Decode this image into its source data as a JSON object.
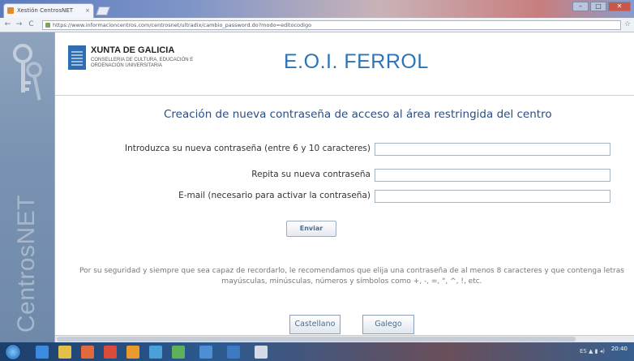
{
  "browser": {
    "tab_title": "Xestión CentrosNET",
    "tab_close": "×",
    "url": "https://www.informacioncentros.com/centrosnet/ultradix/cambio_password.do?modo=editocodigo",
    "back_glyph": "←",
    "forward_glyph": "→",
    "reload_glyph": "C",
    "tools_glyph": "☆",
    "window_buttons": [
      "–",
      "□",
      "✕"
    ]
  },
  "sidebar": {
    "brand": "CentrosNET",
    "icon": "keys-icon"
  },
  "header": {
    "org_name": "XUNTA DE GALICIA",
    "org_subtitle": "CONSELLERIA DE CULTURA, EDUCACIÓN E ORDENACIÓN UNIVERSITARIA",
    "school_title": "E.O.I.  FERROL"
  },
  "main": {
    "heading": "Creación de nueva contraseña de acceso al área restringida del centro",
    "fields": [
      {
        "label": "Introduzca su nueva contraseña (entre 6 y 10 caracteres)",
        "value": "",
        "placeholder": ""
      },
      {
        "label": "Repita su nueva contraseña",
        "value": "",
        "placeholder": ""
      },
      {
        "label": "E-mail (necesario para activar la contraseña)",
        "value": "",
        "placeholder": ""
      }
    ],
    "submit_label": "Enviar",
    "advice": "Por su seguridad y siempre que sea capaz de recordarlo, le recomendamos que elija una contraseña de al menos 8 caracteres y que contenga letras mayúsculas, minúsculas, números y símbolos como +, -, =, \", ^, !, etc.",
    "languages": [
      "Castellano",
      "Galego"
    ]
  },
  "taskbar": {
    "tray_text": "ES ▲ ▮ ◂)",
    "clock": "20:40"
  },
  "colors": {
    "accent": "#2a74b8",
    "heading": "#2b4d80",
    "sidebar": "#7a93b2",
    "button_text": "#4a6c94"
  }
}
